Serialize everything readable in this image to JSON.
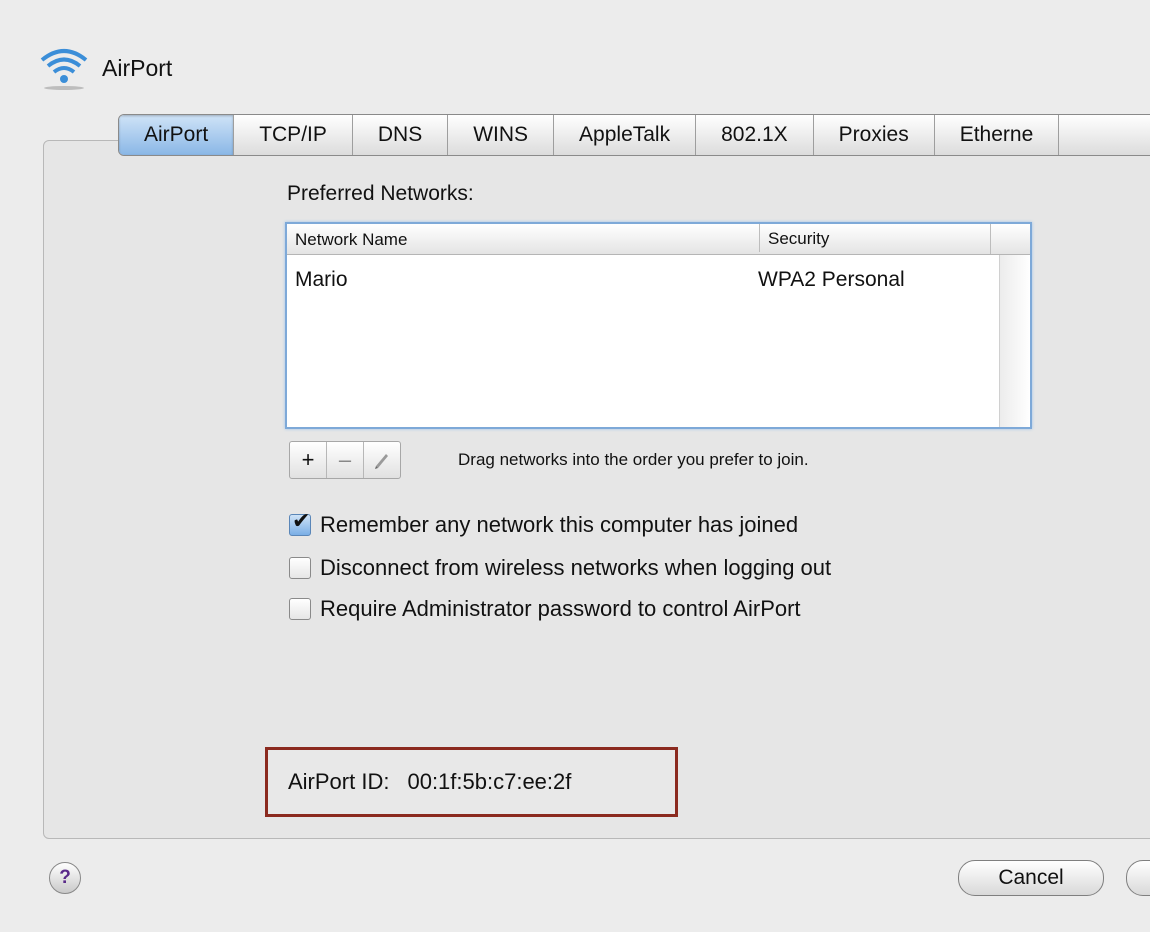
{
  "header": {
    "title": "AirPort",
    "icon": "wifi-icon"
  },
  "tabs": [
    {
      "label": "AirPort",
      "active": true
    },
    {
      "label": "TCP/IP",
      "active": false
    },
    {
      "label": "DNS",
      "active": false
    },
    {
      "label": "WINS",
      "active": false
    },
    {
      "label": "AppleTalk",
      "active": false
    },
    {
      "label": "802.1X",
      "active": false
    },
    {
      "label": "Proxies",
      "active": false
    },
    {
      "label": "Etherne",
      "active": false
    }
  ],
  "preferred": {
    "label": "Preferred Networks:",
    "columns": [
      "Network Name",
      "Security"
    ],
    "rows": [
      {
        "name": "Mario",
        "security": "WPA2 Personal"
      }
    ]
  },
  "controls": {
    "add": "+",
    "remove": "–",
    "edit_icon": "pencil-icon",
    "hint": "Drag networks into the order you prefer to join."
  },
  "options": [
    {
      "label": "Remember any network this computer has joined",
      "checked": true
    },
    {
      "label": "Disconnect from wireless networks when logging out",
      "checked": false
    },
    {
      "label": "Require Administrator password to control AirPort",
      "checked": false
    }
  ],
  "airport_id": {
    "label": "AirPort ID:",
    "value": "00:1f:5b:c7:ee:2f"
  },
  "footer": {
    "help": "?",
    "cancel": "Cancel"
  },
  "colors": {
    "highlight_border": "#8b2a1f",
    "selection_blue": "#7ea9d8"
  }
}
